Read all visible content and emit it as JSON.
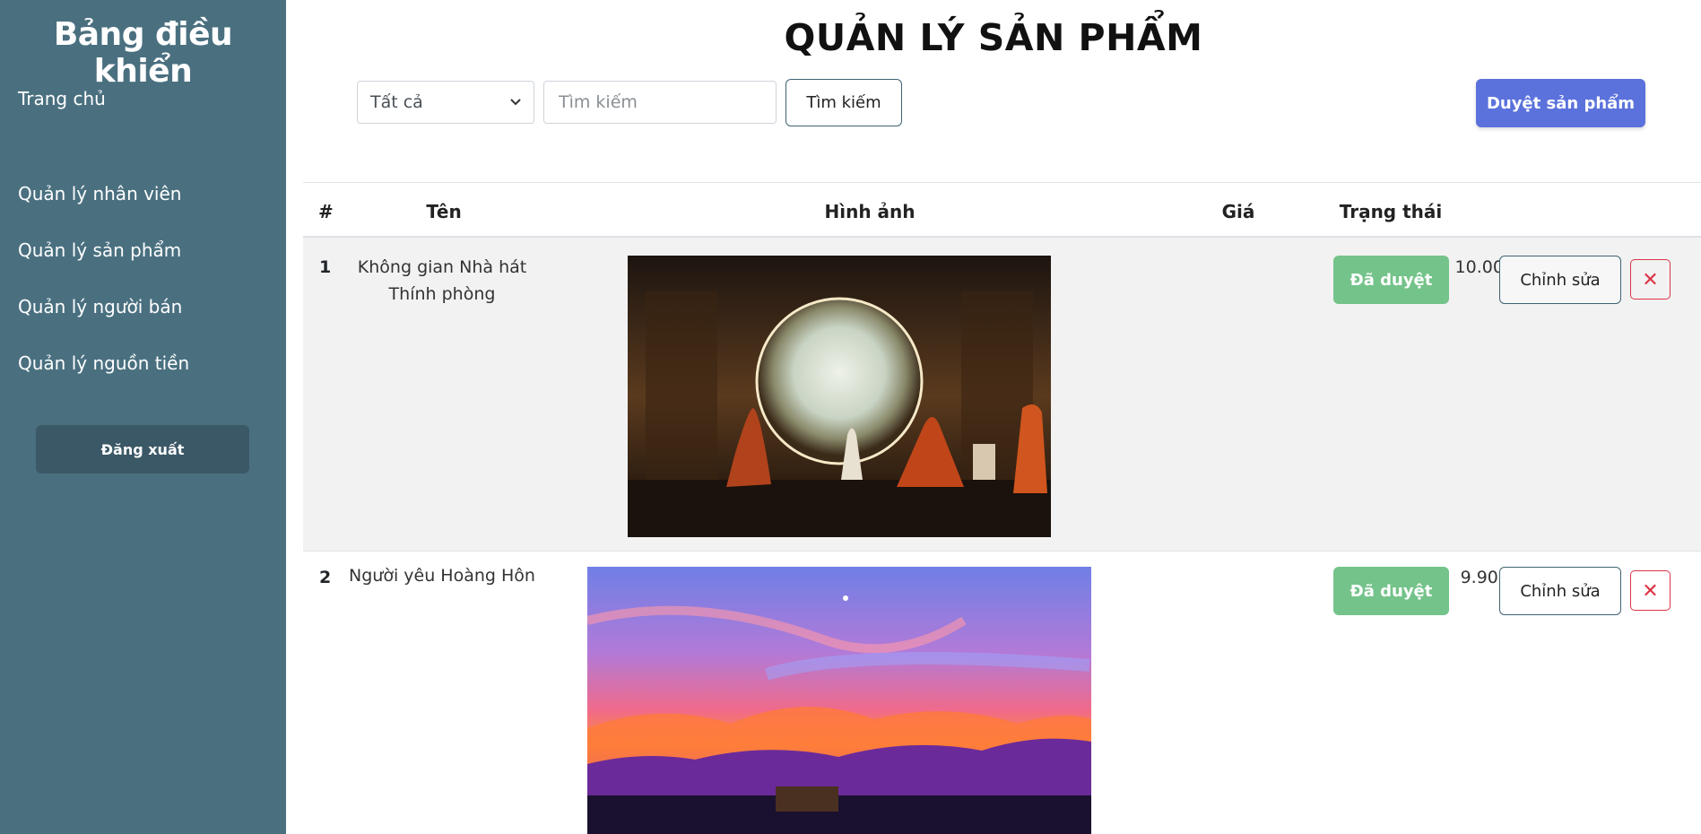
{
  "sidebar": {
    "title": "Bảng điều khiển",
    "items": [
      {
        "label": "Trang chủ"
      },
      {
        "label": "Quản lý nhân viên"
      },
      {
        "label": "Quản lý sản phẩm"
      },
      {
        "label": "Quản lý người bán"
      },
      {
        "label": "Quản lý nguồn tiền"
      }
    ],
    "logout_label": "Đăng xuất"
  },
  "main": {
    "title": "QUẢN LÝ SẢN PHẨM",
    "filter": {
      "selected": "Tất cả"
    },
    "search": {
      "placeholder": "Tìm kiếm",
      "button_label": "Tìm kiếm"
    },
    "approve_button": "Duyệt sản phẩm"
  },
  "table": {
    "headers": [
      "#",
      "Tên",
      "Hình ảnh",
      "Giá",
      "Trạng thái"
    ],
    "rows": [
      {
        "index": "1",
        "name_line1": "Không gian Nhà hát",
        "name_line2": "Thính phòng",
        "price": "10.000.000 ₫",
        "status": "Đã duyệt",
        "edit_label": "Chỉnh sửa",
        "delete_label": "✕"
      },
      {
        "index": "2",
        "name_line1": "Người yêu Hoàng Hôn",
        "price": "9.900.000 ₫",
        "status": "Đã duyệt",
        "edit_label": "Chỉnh sửa",
        "delete_label": "✕"
      }
    ]
  },
  "colors": {
    "sidebar_bg": "#4a7080",
    "logout_bg": "#3b5866",
    "primary": "#5b72dc",
    "success": "#74c38a",
    "danger": "#dc3545"
  }
}
